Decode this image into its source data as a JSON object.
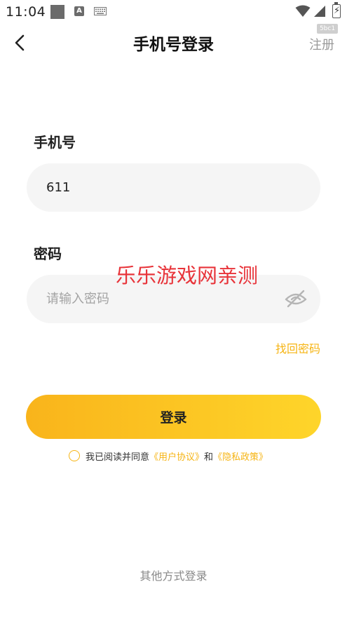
{
  "status_bar": {
    "time": "11:04",
    "code": "5bc1",
    "icons": [
      "notification-square-icon",
      "a-app-icon",
      "keyboard-icon",
      "wifi-icon",
      "signal-icon",
      "battery-charging-icon"
    ]
  },
  "header": {
    "title": "手机号登录",
    "register_label": "注册",
    "back_icon": "chevron-left-icon"
  },
  "form": {
    "phone_label": "手机号",
    "phone_value": "611",
    "password_label": "密码",
    "password_placeholder": "请输入密码",
    "password_toggle_icon": "eye-off-icon",
    "forgot_label": "找回密码",
    "login_label": "登录"
  },
  "agreement": {
    "prefix": "我已阅读并同意",
    "user_agreement": "《用户协议》",
    "conjunction": "和",
    "privacy_policy": "《隐私政策》"
  },
  "watermark": "乐乐游戏网亲测",
  "other_login_label": "其他方式登录",
  "colors": {
    "accent": "#f6b413",
    "button_gradient_start": "#f9b41b",
    "button_gradient_end": "#fed52a",
    "input_bg": "#f5f5f5",
    "watermark": "#e8343a"
  }
}
